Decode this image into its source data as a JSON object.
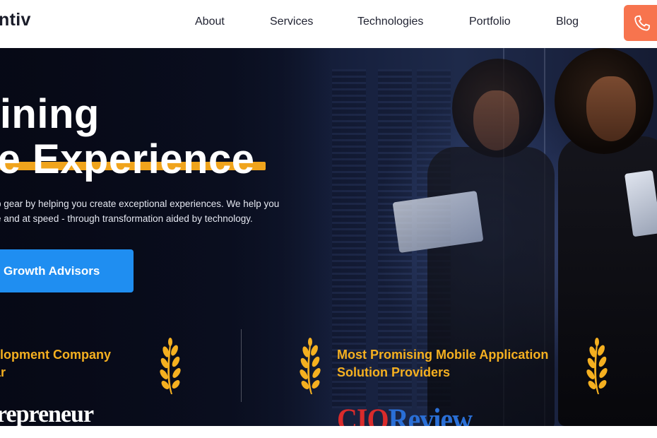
{
  "header": {
    "logo_text": "ntiv",
    "nav": [
      {
        "label": "About"
      },
      {
        "label": "Services"
      },
      {
        "label": "Technologies"
      },
      {
        "label": "Portfolio"
      },
      {
        "label": "Blog"
      }
    ],
    "call_icon": "phone-icon"
  },
  "hero": {
    "headline_line1": "fining",
    "headline_line2": "le Experience",
    "description_line1": "p gear by helping you create exceptional experiences. We help you",
    "description_line2": "e and at speed - through transformation aided by technology.",
    "cta_label": "Growth Advisors",
    "awards": [
      {
        "line1": "evelopment Company",
        "line2": "Year",
        "icon": "laurel-icon"
      },
      {
        "line1": "Most Promising Mobile Application",
        "line2": "Solution Providers",
        "icon": "laurel-icon"
      }
    ],
    "publications": {
      "entrepreneur": "repreneur",
      "cio_part1": "CIO",
      "cio_part2": "Review"
    }
  },
  "colors": {
    "accent_orange": "#f7744e",
    "cta_blue": "#1f8ef1",
    "award_gold": "#f5b020",
    "highlight_yellow": "#f0a41c",
    "hero_dark": "#0a0e1f"
  }
}
